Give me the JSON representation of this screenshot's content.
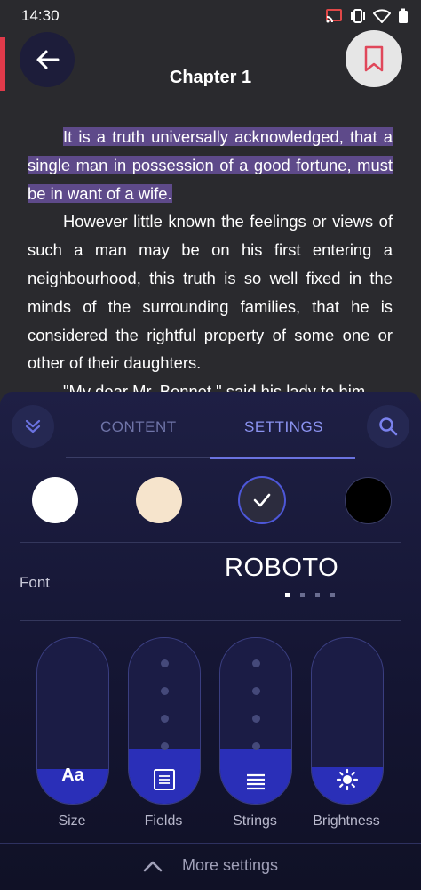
{
  "status_bar": {
    "time": "14:30",
    "icons": [
      "cast-icon",
      "vibrate-icon",
      "wifi-icon",
      "battery-icon"
    ]
  },
  "header": {
    "title": "Chapter 1",
    "back_icon": "arrow-left-icon",
    "bookmark_icon": "bookmark-icon"
  },
  "book": {
    "highlighted": "It is a truth universally acknowledged, that a single man in possession of a good fortune, must be in want of a wife.",
    "paragraph2": "However little known the feelings or views of such a man may be on his first entering a neighbourhood, this truth is so well fixed in the minds of the surrounding families, that he is considered the rightful property of some one or other of their daughters.",
    "paragraph3_partial": "\"My dear Mr. Bennet,\" said his lady to him"
  },
  "settings_panel": {
    "tabs": [
      {
        "label": "CONTENT",
        "active": false
      },
      {
        "label": "SETTINGS",
        "active": true
      }
    ],
    "themes": [
      {
        "name": "white",
        "color": "#ffffff",
        "selected": false
      },
      {
        "name": "sepia",
        "color": "#f6e4cc",
        "selected": false
      },
      {
        "name": "dark",
        "color": "#2c2c3e",
        "selected": true
      },
      {
        "name": "black",
        "color": "#000000",
        "selected": false
      }
    ],
    "font_label": "Font",
    "font_name": "ROBOTO",
    "font_page": {
      "current": 1,
      "total": 4
    },
    "sliders": [
      {
        "label": "Size",
        "icon_text": "Aa",
        "icon": "text-size-icon",
        "level": 0.21
      },
      {
        "label": "Fields",
        "icon": "margins-icon",
        "level": 0.33
      },
      {
        "label": "Strings",
        "icon": "line-spacing-icon",
        "level": 0.33
      },
      {
        "label": "Brightness",
        "icon": "brightness-icon",
        "level": 0.22
      }
    ],
    "more_settings": "More settings"
  },
  "colors": {
    "accent": "#6a72e0",
    "highlight": "#5e4a8a",
    "slider_fill": "#2a2fb8",
    "bookmark": "#e0475a"
  }
}
